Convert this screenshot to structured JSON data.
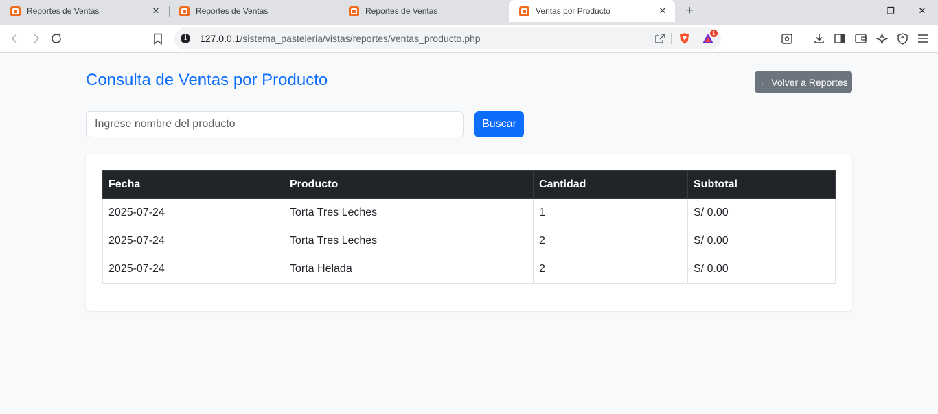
{
  "browser": {
    "tabs": [
      {
        "title": "Reportes de Ventas",
        "active": false
      },
      {
        "title": "Reportes de Ventas",
        "active": false
      },
      {
        "title": "Reportes de Ventas",
        "active": false
      },
      {
        "title": "Ventas por Producto",
        "active": true
      }
    ],
    "new_tab": "+",
    "close_glyph": "✕",
    "window_controls": {
      "minimize": "—",
      "restore": "❐",
      "close": "✕"
    },
    "url_host": "127.0.0.1",
    "url_path": "/sistema_pasteleria/vistas/reportes/ventas_producto.php",
    "info_glyph": "i",
    "notification_count": "1"
  },
  "page": {
    "title": "Consulta de Ventas por Producto",
    "back_button": "← Volver a Reportes",
    "search": {
      "placeholder": "Ingrese nombre del producto",
      "value": ""
    },
    "search_button": "Buscar",
    "table": {
      "headers": [
        "Fecha",
        "Producto",
        "Cantidad",
        "Subtotal"
      ],
      "rows": [
        [
          "2025-07-24",
          "Torta Tres Leches",
          "1",
          "S/ 0.00"
        ],
        [
          "2025-07-24",
          "Torta Tres Leches",
          "2",
          "S/ 0.00"
        ],
        [
          "2025-07-24",
          "Torta Helada",
          "2",
          "S/ 0.00"
        ]
      ]
    }
  },
  "colors": {
    "primary": "#0d6efd",
    "secondary": "#6c757d",
    "table_header": "#212529",
    "page_bg": "#f8f9fa",
    "favicon": "#f26b1d"
  }
}
